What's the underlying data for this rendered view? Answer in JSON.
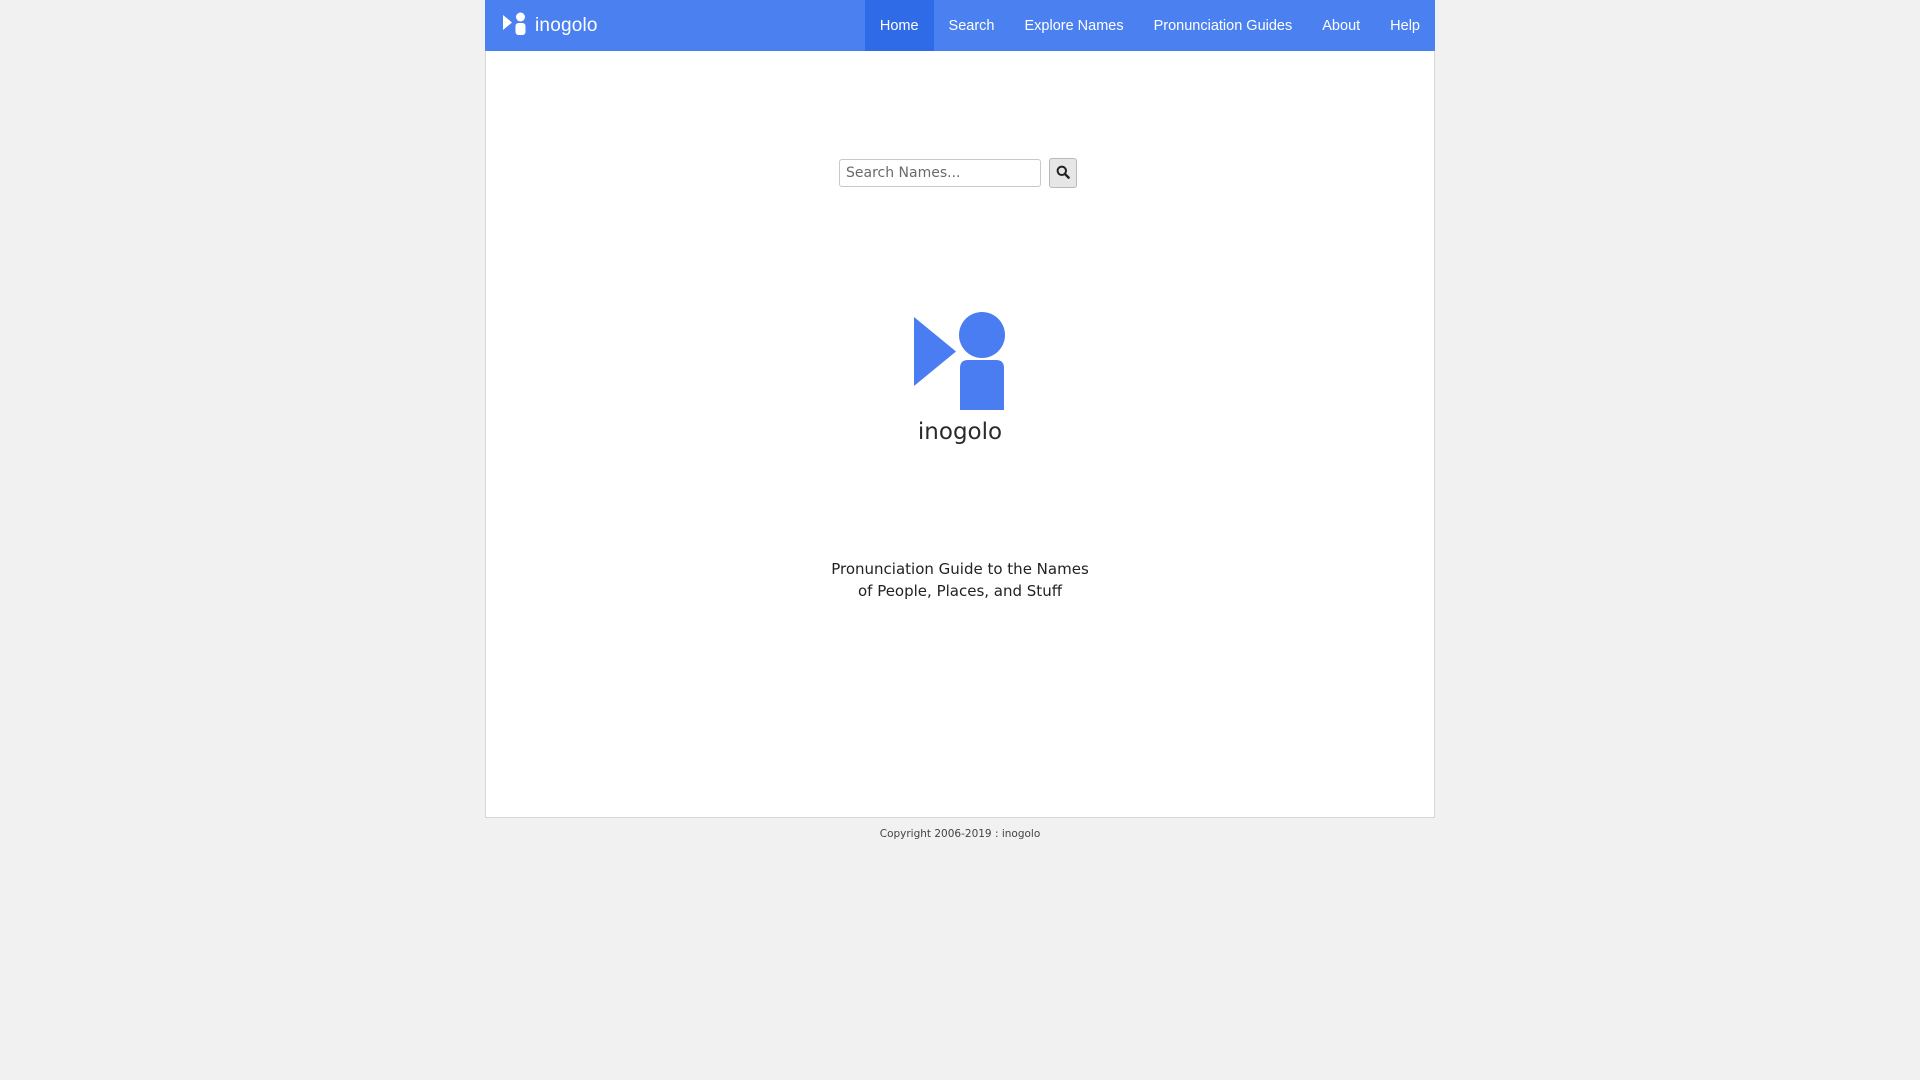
{
  "navbar": {
    "brand": "inogolo",
    "items": [
      {
        "label": "Home",
        "active": true
      },
      {
        "label": "Search",
        "active": false
      },
      {
        "label": "Explore Names",
        "active": false
      },
      {
        "label": "Pronunciation Guides",
        "active": false
      },
      {
        "label": "About",
        "active": false
      },
      {
        "label": "Help",
        "active": false
      }
    ]
  },
  "search": {
    "placeholder": "Search Names...",
    "button_icon": "search-icon"
  },
  "hero": {
    "title": "inogolo",
    "tagline_line1": "Pronunciation Guide to the Names",
    "tagline_line2": "of People, Places, and Stuff"
  },
  "footer": {
    "copyright": "Copyright 2006-2019 : inogolo"
  },
  "colors": {
    "brand": "#4a80f0",
    "active_nav": "#2f6ae7",
    "logo": "#4a7df1"
  }
}
